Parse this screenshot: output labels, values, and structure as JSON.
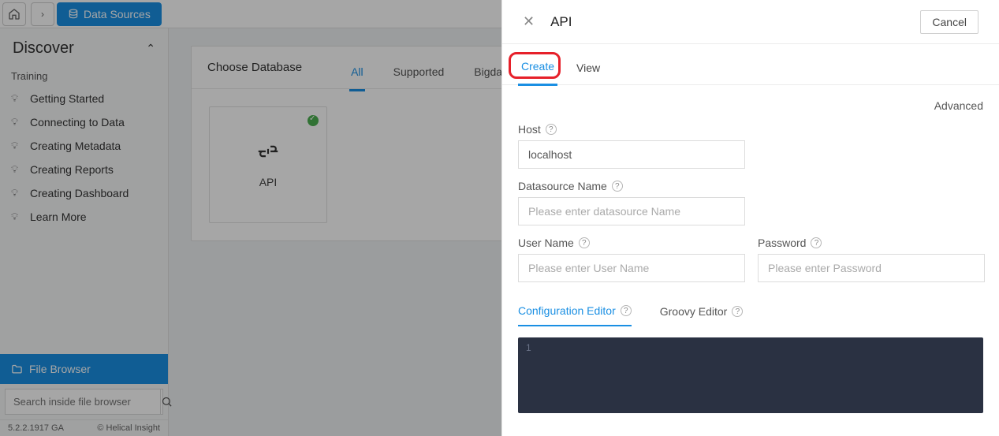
{
  "breadcrumb": {
    "current": "Data Sources"
  },
  "sidebar": {
    "title": "Discover",
    "section": "Training",
    "items": [
      {
        "label": "Getting Started"
      },
      {
        "label": "Connecting to Data"
      },
      {
        "label": "Creating Metadata"
      },
      {
        "label": "Creating Reports"
      },
      {
        "label": "Creating Dashboard"
      },
      {
        "label": "Learn More"
      }
    ],
    "file_browser": "File Browser",
    "search_placeholder": "Search inside file browser",
    "version": "5.2.2.1917 GA",
    "copyright": "© Helical Insight"
  },
  "main": {
    "choose_db": "Choose Database",
    "tabs": {
      "all": "All",
      "supported": "Supported",
      "bigdata": "Bigdata"
    },
    "tile": {
      "label": "API"
    }
  },
  "panel": {
    "title": "API",
    "cancel": "Cancel",
    "tabs": {
      "create": "Create",
      "view": "View"
    },
    "advanced": "Advanced",
    "fields": {
      "host_label": "Host",
      "host_value": "localhost",
      "ds_label": "Datasource Name",
      "ds_placeholder": "Please enter datasource Name",
      "user_label": "User Name",
      "user_placeholder": "Please enter User Name",
      "pw_label": "Password",
      "pw_placeholder": "Please enter Password"
    },
    "editor_tabs": {
      "config": "Configuration Editor",
      "groovy": "Groovy Editor"
    },
    "code": {
      "line1": "1"
    }
  }
}
